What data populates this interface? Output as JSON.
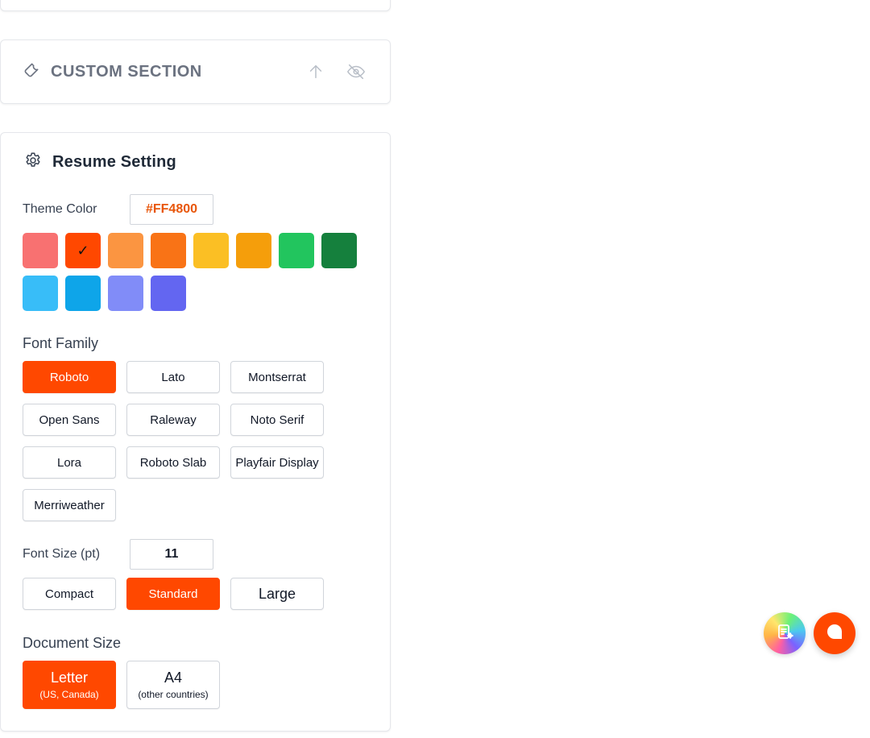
{
  "custom_section": {
    "title": "CUSTOM SECTION",
    "icons": [
      "wrench-icon",
      "arrow-up-icon",
      "eye-off-icon"
    ]
  },
  "resume_setting": {
    "title": "Resume Setting",
    "theme_color": {
      "label": "Theme Color",
      "value": "#FF4800",
      "swatches": [
        "#f87171",
        "#ff4800",
        "#fb9541",
        "#f97316",
        "#fbbf24",
        "#f59e0b",
        "#22c55e",
        "#15803d",
        "#38bdf8",
        "#0ea5e9",
        "#818cf8",
        "#6366f1"
      ],
      "selected_index": 1,
      "selected_mark": "✓"
    },
    "font_family": {
      "label": "Font Family",
      "options": [
        "Roboto",
        "Lato",
        "Montserrat",
        "Open Sans",
        "Raleway",
        "Noto Serif",
        "Lora",
        "Roboto Slab",
        "Playfair Display",
        "Merriweather"
      ],
      "selected": "Roboto"
    },
    "font_size": {
      "label": "Font Size (pt)",
      "value": "11",
      "presets": [
        "Compact",
        "Standard",
        "Large"
      ],
      "selected": "Standard"
    },
    "document_size": {
      "label": "Document Size",
      "options": [
        {
          "label": "Letter",
          "sub": "(US, Canada)"
        },
        {
          "label": "A4",
          "sub": "(other countries)"
        }
      ],
      "selected": "Letter"
    }
  },
  "fabs": {
    "ai_icon": "document-sparkle-icon",
    "chat_icon": "chat-bubble-icon"
  },
  "colors": {
    "accent": "#ff4800",
    "border": "#d1d5db"
  }
}
